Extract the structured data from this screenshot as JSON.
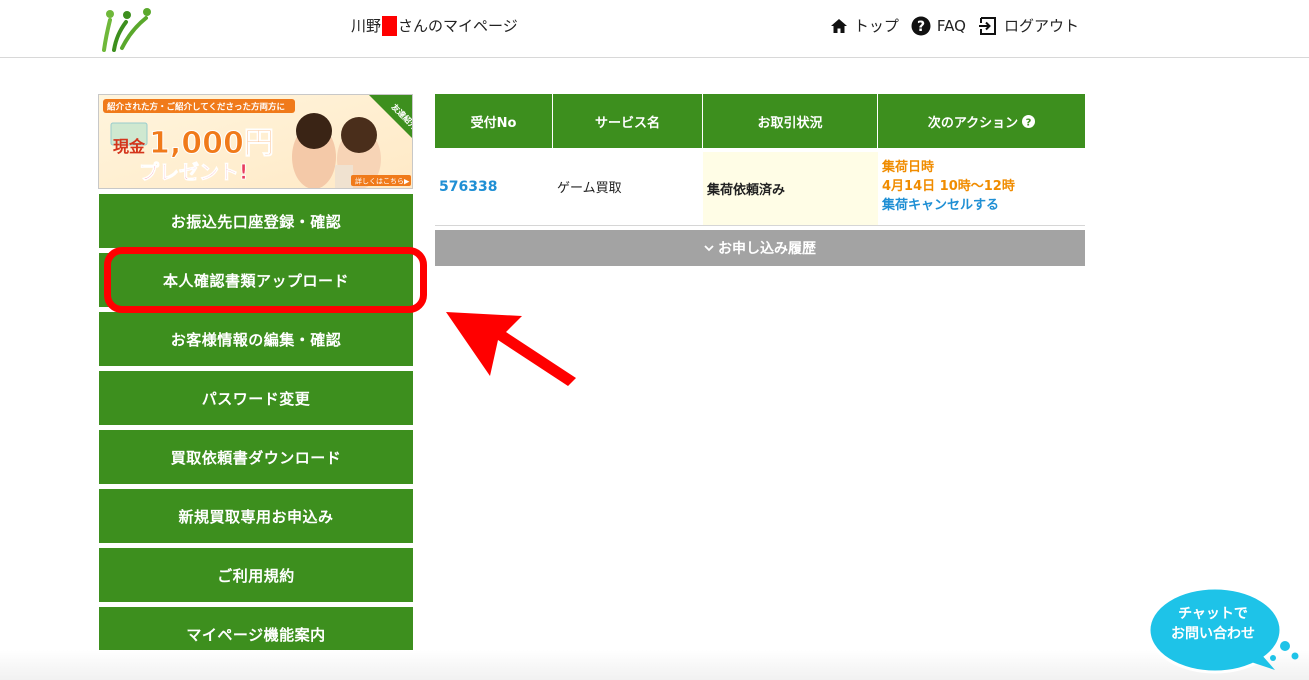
{
  "header": {
    "user_name": "川野",
    "greeting_suffix": "さんのマイページ",
    "name_block_color": "#ff0000",
    "nav": [
      {
        "label": "トップ",
        "icon": "home-icon"
      },
      {
        "label": "FAQ",
        "icon": "help-circle-icon"
      },
      {
        "label": "ログアウト",
        "icon": "logout-icon"
      }
    ]
  },
  "banner": {
    "top_text": "紹介された方・ご紹介してくださった方両方に",
    "tag": "友達紹介",
    "prefix": "現金",
    "amount": "1,000円",
    "present": "プレゼント!",
    "detail": "詳しくはこちら▶"
  },
  "sidebar": {
    "items": [
      {
        "label": "お振込先口座登録・確認"
      },
      {
        "label": "本人確認書類アップロード"
      },
      {
        "label": "お客様情報の編集・確認"
      },
      {
        "label": "パスワード変更"
      },
      {
        "label": "買取依頼書ダウンロード"
      },
      {
        "label": "新規買取専用お申込み"
      },
      {
        "label": "ご利用規約"
      },
      {
        "label": "マイページ機能案内"
      }
    ]
  },
  "orders_table": {
    "headers": [
      "受付No",
      "サービス名",
      "お取引状況",
      "次のアクション"
    ],
    "header_help_icon": "help-circle-icon",
    "rows": [
      {
        "receipt_no": "576338",
        "service": "ゲーム買取",
        "status": "集荷依頼済み",
        "action_title": "集荷日時",
        "action_datetime": "4月14日 10時〜12時",
        "action_link": "集荷キャンセルする"
      }
    ],
    "history_label": "お申し込み履歴",
    "history_icon": "chevron-down-icon"
  },
  "chat": {
    "line1": "チャットで",
    "line2": "お問い合わせ"
  },
  "colors": {
    "primary_green": "#3d8f1e",
    "link_blue": "#1f8fd4",
    "orange": "#f08c00",
    "highlight_red": "#ff0000",
    "chat_cyan": "#1ec3e8"
  }
}
